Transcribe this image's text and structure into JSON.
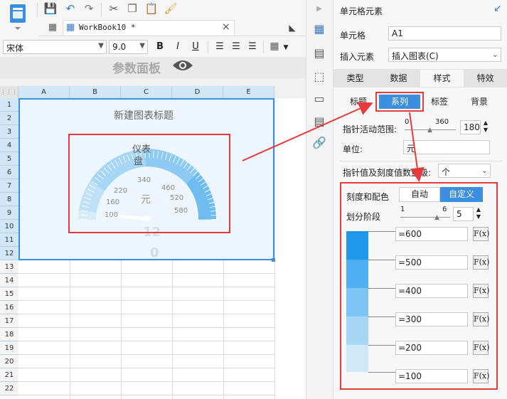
{
  "toolbar": {
    "workbook_tab": "WorkBook10 *",
    "font_name": "宋体",
    "font_size": "9.0",
    "bold": "B",
    "italic": "I",
    "underline": "U"
  },
  "param_panel": {
    "title": "参数面板"
  },
  "sheet": {
    "columns": [
      "A",
      "B",
      "C",
      "D",
      "E"
    ],
    "rows": [
      "1",
      "2",
      "3",
      "4",
      "5",
      "6",
      "7",
      "8",
      "9",
      "10",
      "11",
      "12",
      "13",
      "14",
      "15",
      "16",
      "17",
      "18",
      "19",
      "20",
      "21",
      "22"
    ]
  },
  "chart": {
    "title": "新建图表标题",
    "gauge_title_line1": "仪表",
    "gauge_title_line2": "盘",
    "unit": "元",
    "ticks": [
      "100",
      "160",
      "220",
      "340",
      "460",
      "520",
      "580"
    ],
    "value_text_1": "12",
    "value_text_2": "0"
  },
  "chart_data": {
    "type": "gauge",
    "title": "新建图表标题",
    "subtitle": "仪表盘",
    "unit": "元",
    "min": 100,
    "max": 600,
    "tick_labels": [
      100,
      160,
      220,
      340,
      460,
      520,
      580
    ],
    "bands": [
      {
        "upto": 200,
        "color": "#d6ecfb"
      },
      {
        "upto": 300,
        "color": "#bfe1f8"
      },
      {
        "upto": 400,
        "color": "#a6d5f6"
      },
      {
        "upto": 500,
        "color": "#8ccaf4"
      },
      {
        "upto": 600,
        "color": "#6fbcf0"
      }
    ],
    "pointer_value": 120
  },
  "panel": {
    "header": "单元格元素",
    "cell_label": "单元格",
    "cell_value": "A1",
    "insert_label": "插入元素",
    "insert_value": "插入图表(C)",
    "main_tabs": [
      "类型",
      "数据",
      "样式",
      "特效"
    ],
    "sub_tabs": [
      "标题",
      "系列",
      "标签",
      "背景"
    ],
    "pointer_range_label": "指针活动范围:",
    "pointer_slider_min": "0",
    "pointer_slider_max": "360",
    "pointer_range_value": "180",
    "unit_label": "单位:",
    "unit_value": "元",
    "magnitude_label": "指针值及刻度值数量级:",
    "magnitude_value": "个",
    "scale_label": "刻度和配色",
    "scale_auto": "自动",
    "scale_custom": "自定义",
    "stages_label": "划分阶段",
    "stages_slider_min": "1",
    "stages_slider_max": "6",
    "stages_value": "5",
    "stops": [
      "=600",
      "=500",
      "=400",
      "=300",
      "=200",
      "=100"
    ],
    "fx_label": "F(x)"
  },
  "colors": {
    "accent": "#3c8ee0",
    "highlight_red": "#e83a3a",
    "band_colors": [
      "#1f98ea",
      "#4fb0f1",
      "#7cc4f4",
      "#a7d7f7",
      "#cfe8fa"
    ]
  }
}
